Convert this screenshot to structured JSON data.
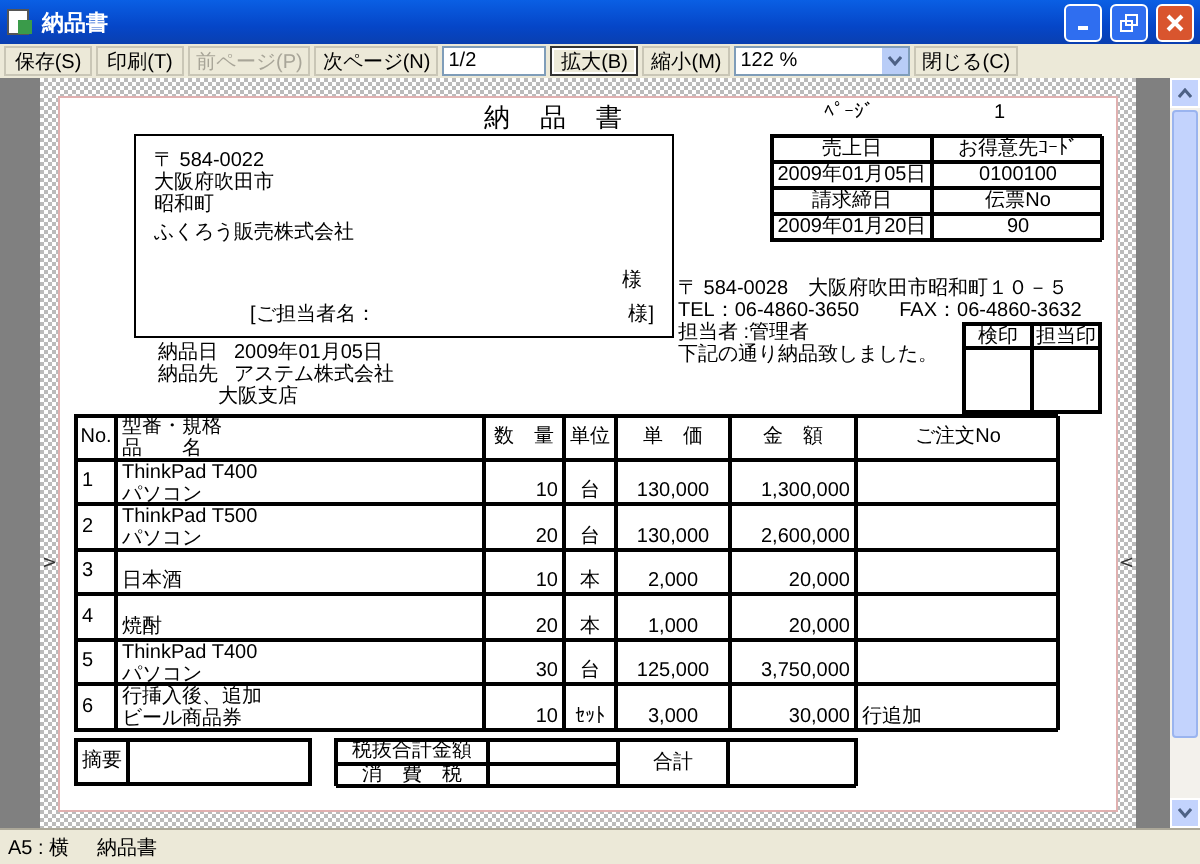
{
  "window": {
    "title": "納品書"
  },
  "toolbar": [
    {
      "kind": "button",
      "label": "保存(S)",
      "disabled": false,
      "pressed": false
    },
    {
      "kind": "button",
      "label": "印刷(T)",
      "disabled": false,
      "pressed": false
    },
    {
      "kind": "button",
      "label": "前ページ(P)",
      "disabled": true,
      "pressed": false
    },
    {
      "kind": "button",
      "label": "次ページ(N)",
      "disabled": false,
      "pressed": false
    },
    {
      "kind": "field",
      "value": "1/2"
    },
    {
      "kind": "button",
      "label": "拡大(B)",
      "disabled": false,
      "pressed": true
    },
    {
      "kind": "button",
      "label": "縮小(M)",
      "disabled": false,
      "pressed": false
    },
    {
      "kind": "select",
      "value": "122 %"
    },
    {
      "kind": "button",
      "label": "閉じる(C)",
      "disabled": false,
      "pressed": false
    }
  ],
  "document": {
    "title": "納　品　書",
    "page_label": "ﾍﾟｰｼﾞ",
    "page_number": "1",
    "info_table": [
      [
        "売上日",
        "お得意先ｺｰﾄﾞ"
      ],
      [
        "2009年01月05日",
        "0100100"
      ],
      [
        "請求締日",
        "伝票No"
      ],
      [
        "2009年01月20日",
        "90"
      ]
    ],
    "recipient": {
      "lines": [
        "〒 584-0022",
        "大阪府吹田市",
        "昭和町",
        "ふくろう販売株式会社"
      ],
      "honorific": "様",
      "contact_label": "[ご担当者名：",
      "contact_honorific": "様]"
    },
    "sender": [
      "〒 584-0028　大阪府吹田市昭和町１０－５",
      "TEL：06-4860-3650　　FAX：06-4860-3632",
      "担当者 :管理者",
      "下記の通り納品致しました。"
    ],
    "stamps": [
      "検印",
      "担当印"
    ],
    "delivery": [
      {
        "label": "納品日",
        "value": "2009年01月05日"
      },
      {
        "label": "納品先",
        "value": "アステム株式会社"
      }
    ],
    "delivery_branch": "大阪支店",
    "columns": [
      "No.",
      [
        "型番・規格",
        "品　　名"
      ],
      "数　量",
      "単位",
      "単　価",
      "金　額",
      "ご注文No"
    ],
    "rows": [
      {
        "no": "1",
        "model": "ThinkPad T400",
        "name": "パソコン",
        "qty": "10",
        "unit": "台",
        "price": "130,000",
        "amount": "1,300,000",
        "order_no": ""
      },
      {
        "no": "2",
        "model": "ThinkPad T500",
        "name": "パソコン",
        "qty": "20",
        "unit": "台",
        "price": "130,000",
        "amount": "2,600,000",
        "order_no": ""
      },
      {
        "no": "3",
        "model": "",
        "name": "日本酒",
        "qty": "10",
        "unit": "本",
        "price": "2,000",
        "amount": "20,000",
        "order_no": ""
      },
      {
        "no": "4",
        "model": "",
        "name": "焼酎",
        "qty": "20",
        "unit": "本",
        "price": "1,000",
        "amount": "20,000",
        "order_no": ""
      },
      {
        "no": "5",
        "model": "ThinkPad T400",
        "name": "パソコン",
        "qty": "30",
        "unit": "台",
        "price": "125,000",
        "amount": "3,750,000",
        "order_no": ""
      },
      {
        "no": "6",
        "model": "行挿入後、追加",
        "name": "ビール商品券",
        "qty": "10",
        "unit": "ｾｯﾄ",
        "price": "3,000",
        "amount": "30,000",
        "order_no": "行追加"
      }
    ],
    "footer": {
      "summary_label": "摘要",
      "tax_labels": [
        "税抜合計金額",
        "消　費　税"
      ],
      "total_label": "合計"
    },
    "markers": {
      "left": ">",
      "right": "<"
    }
  },
  "status_bar": [
    "A5 : 横",
    "納品書"
  ]
}
